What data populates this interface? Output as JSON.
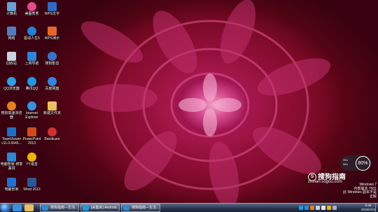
{
  "desktop": {
    "icons": [
      {
        "label": "计算机",
        "color": "#6aa0d8"
      },
      {
        "label": "网络",
        "color": "#4d7fc0"
      },
      {
        "label": "回收站",
        "color": "#c8d4e2"
      },
      {
        "label": "QQ浏览器",
        "color": "#2ea0e8"
      },
      {
        "label": "搜狗高速浏览器",
        "color": "#e57f1f"
      },
      {
        "label": "TeamViewer v11.0.6545...",
        "color": "#1e6fc8"
      },
      {
        "label": "电脑管家-修复漏洞",
        "color": "#2a8ad4"
      },
      {
        "label": "电脑管家",
        "color": "#1c74d0"
      },
      {
        "label": "美图秀秀",
        "color": "#e24a8c"
      },
      {
        "label": "驱动人生5",
        "color": "#2580d8"
      },
      {
        "label": "上网导航",
        "color": "#2c84dc"
      },
      {
        "label": "腾讯QQ",
        "color": "#1d99e6"
      },
      {
        "label": "Internet Explorer",
        "color": "#3a8fe0"
      },
      {
        "label": "PowerPoint 2013",
        "color": "#d04a1e"
      },
      {
        "label": "YY语音",
        "color": "#f0b400"
      },
      {
        "label": "Word 2013",
        "color": "#2b5797"
      },
      {
        "label": "WPS文字",
        "color": "#2d6cc4"
      },
      {
        "label": "WPS演示",
        "color": "#e5672b"
      },
      {
        "label": "搜狗影音",
        "color": "#3a72c8"
      },
      {
        "label": "百度网盘",
        "color": "#2f87e0"
      },
      {
        "label": "新建文件夹",
        "color": "#e8c060"
      },
      {
        "label": "Bandicam",
        "color": "#d03030"
      }
    ]
  },
  "taskbar": {
    "tasks": [
      {
        "label": "搜狗指南—生活..."
      },
      {
        "label": "[采集的] Android..."
      },
      {
        "label": "搜狗指南—生活..."
      }
    ],
    "clock": {
      "time": "0:45",
      "date": "2018/4/13"
    }
  },
  "watermark": {
    "line1": "Windows 7",
    "line2": "内部版本 7601",
    "line3": "此 Windows 副本不是正版"
  },
  "overlay": {
    "brand": "搜狗指南",
    "url": "zhinan.sogou.com"
  },
  "speed_widget": {
    "percent": "80%",
    "up": "0K/s",
    "down": "0K/s"
  }
}
